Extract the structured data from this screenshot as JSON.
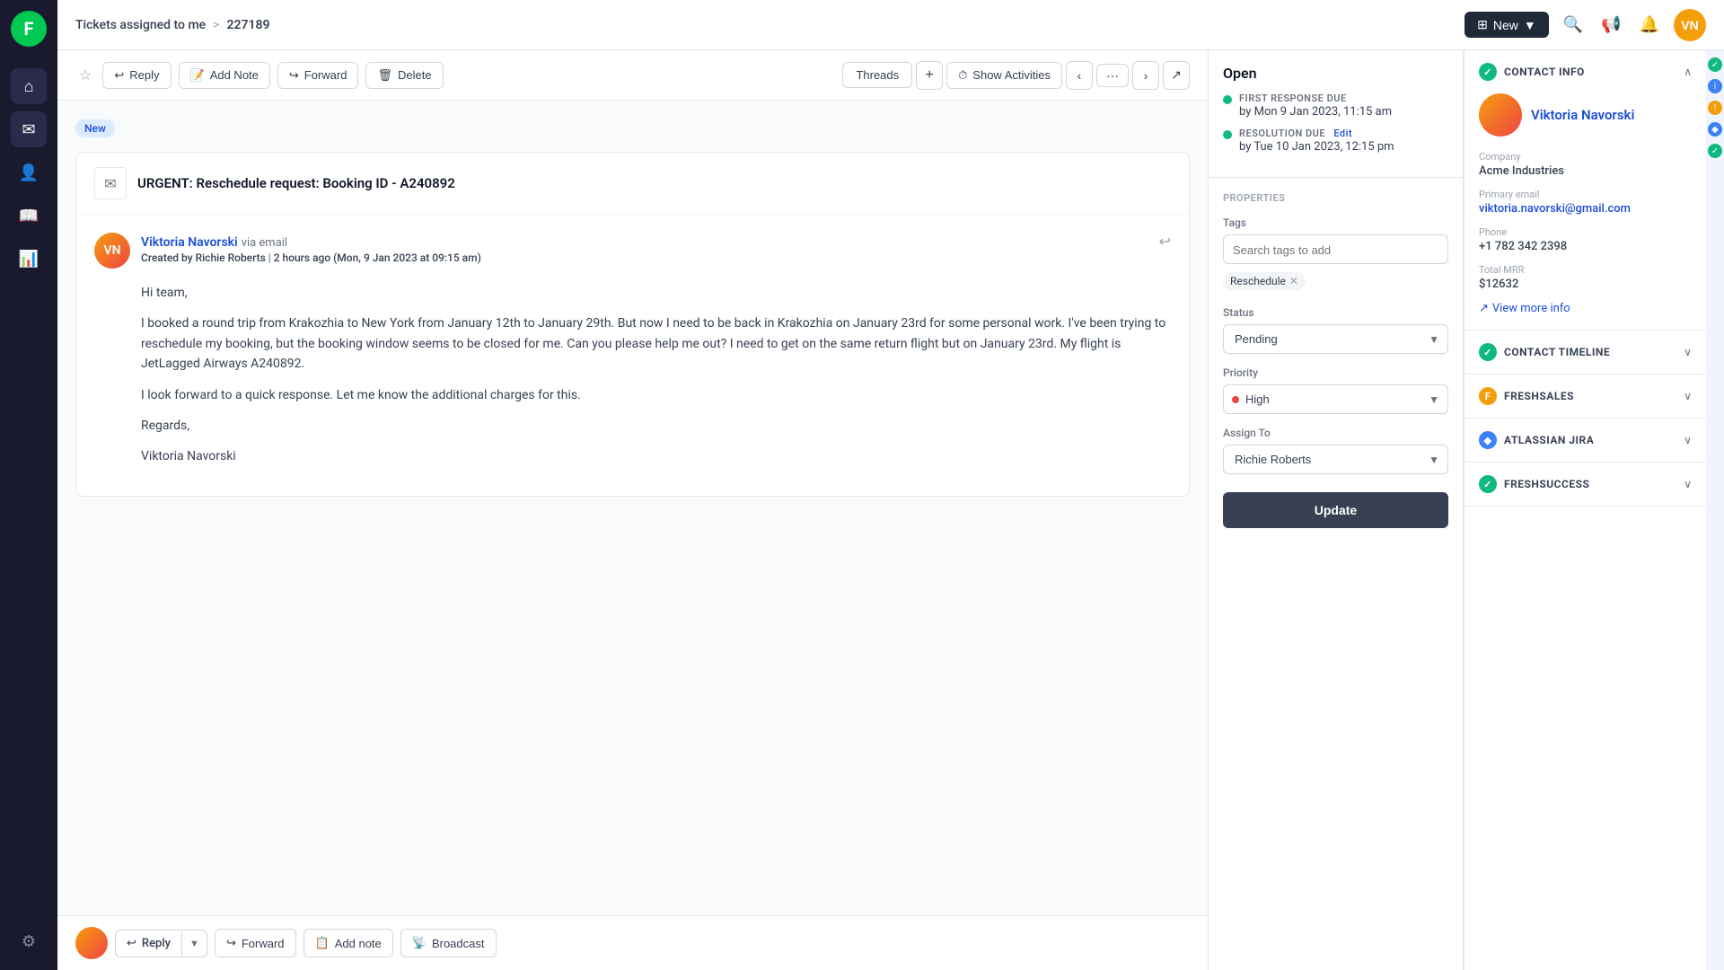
{
  "app": {
    "logo": "F"
  },
  "header": {
    "breadcrumb_link": "Tickets assigned to me",
    "breadcrumb_sep": ">",
    "ticket_number": "227189",
    "new_btn": "New",
    "new_btn_icon": "▼"
  },
  "toolbar": {
    "reply_label": "Reply",
    "add_note_label": "Add Note",
    "forward_label": "Forward",
    "delete_label": "Delete",
    "threads_label": "Threads",
    "plus_label": "+",
    "show_activities_label": "Show Activities",
    "prev_label": "‹",
    "next_label": "›",
    "more_label": "···",
    "expand_label": "↗"
  },
  "email": {
    "new_badge": "New",
    "subject": "URGENT: Reschedule request: Booking ID - A240892",
    "sender_name": "Viktoria Navorski",
    "sender_via": "via email",
    "created_by": "Created by Richie Roberts",
    "time_ago": "2 hours ago",
    "timestamp": "(Mon, 9 Jan 2023 at 09:15 am)",
    "body_greeting": "Hi team,",
    "body_p1": "I booked a round trip from Krakozhia to New York from January 12th to January 29th. But now I need to be back in Krakozhia on January 23rd for some personal work. I've been trying to reschedule my booking, but the booking window seems to be closed for me. Can you please help me out? I need to get on the same return flight but on January 23rd. My flight is JetLagged Airways A240892.",
    "body_p2": "I look forward to a quick response. Let me know the additional charges for this.",
    "body_regards": "Regards,",
    "body_name": "Viktoria Navorski"
  },
  "reply_bar": {
    "reply_label": "Reply",
    "forward_label": "Forward",
    "add_note_label": "Add note",
    "broadcast_label": "Broadcast",
    "dropdown_arrow": "▼"
  },
  "ticket_panel": {
    "status": "Open",
    "first_response_label": "FIRST RESPONSE DUE",
    "first_response_by": "by  Mon 9 Jan 2023, 11:15 am",
    "resolution_label": "RESOLUTION DUE",
    "resolution_edit": "Edit",
    "resolution_by": "by  Tue 10 Jan 2023, 12:15 pm",
    "properties_label": "PROPERTIES",
    "tags_label": "Tags",
    "tags_placeholder": "Search tags to add",
    "tag_reschedule": "Reschedule",
    "status_label": "Status",
    "status_value": "Pending",
    "priority_label": "Priority",
    "priority_value": "High",
    "assign_label": "Assign To",
    "assign_value": "Richie Roberts",
    "update_btn": "Update"
  },
  "contact_panel": {
    "contact_info_label": "CONTACT INFO",
    "contact_name": "Viktoria Navorski",
    "company_label": "Company",
    "company_value": "Acme Industries",
    "email_label": "Primary email",
    "email_value": "viktoria.navorski@gmail.com",
    "phone_label": "Phone",
    "phone_value": "+1 782 342 2398",
    "mrr_label": "Total MRR",
    "mrr_value": "$12632",
    "view_more": "View more info",
    "timeline_label": "CONTACT TIMELINE",
    "freshsales_label": "FRESHSALES",
    "jira_label": "ATLASSIAN JIRA",
    "freshsuccess_label": "FRESHSUCCESS"
  },
  "sidebar": {
    "items": [
      {
        "name": "home",
        "icon": "⌂",
        "active": false
      },
      {
        "name": "inbox",
        "icon": "✉",
        "active": true
      },
      {
        "name": "contacts",
        "icon": "👤",
        "active": false
      },
      {
        "name": "knowledge",
        "icon": "📖",
        "active": false
      },
      {
        "name": "reports",
        "icon": "📊",
        "active": false
      },
      {
        "name": "settings",
        "icon": "⚙",
        "active": false
      }
    ]
  }
}
